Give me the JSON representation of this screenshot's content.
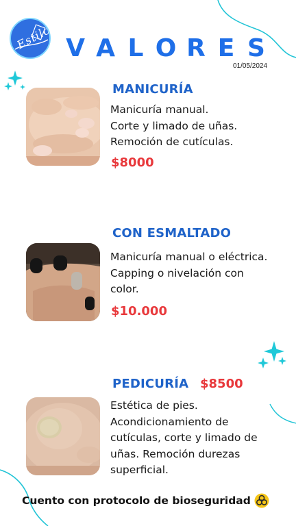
{
  "logo": {
    "text": "Estilo"
  },
  "header": {
    "title_letters": [
      "V",
      "A",
      "L",
      "O",
      "R",
      "E",
      "S"
    ],
    "date": "01/05/2024"
  },
  "services": [
    {
      "title": "MANICURÍA",
      "lines": [
        "Manicuría manual.",
        "Corte y limado de uñas.",
        "Remoción de cutículas."
      ],
      "price": "$8000",
      "image": "manicure-hand-photo"
    },
    {
      "title": "CON ESMALTADO",
      "lines": [
        "Manicuría manual o eléctrica.",
        "Capping o nivelación con",
        "color."
      ],
      "price": "$10.000",
      "image": "enamel-nails-photo"
    },
    {
      "title": "PEDICURÍA",
      "lines": [
        "Estética de pies.",
        "Acondicionamiento de",
        "cutículas, corte y limado de",
        "uñas. Remoción durezas",
        "superficial."
      ],
      "price": "$8500",
      "image": "pedicure-toe-photo"
    }
  ],
  "footer": {
    "text": "Cuento con protocolo de bioseguridad",
    "icon": "biohazard-icon"
  },
  "colors": {
    "heading": "#1f63c9",
    "title": "#1f6fe8",
    "price": "#e8383b",
    "accent": "#1fc8d8"
  }
}
